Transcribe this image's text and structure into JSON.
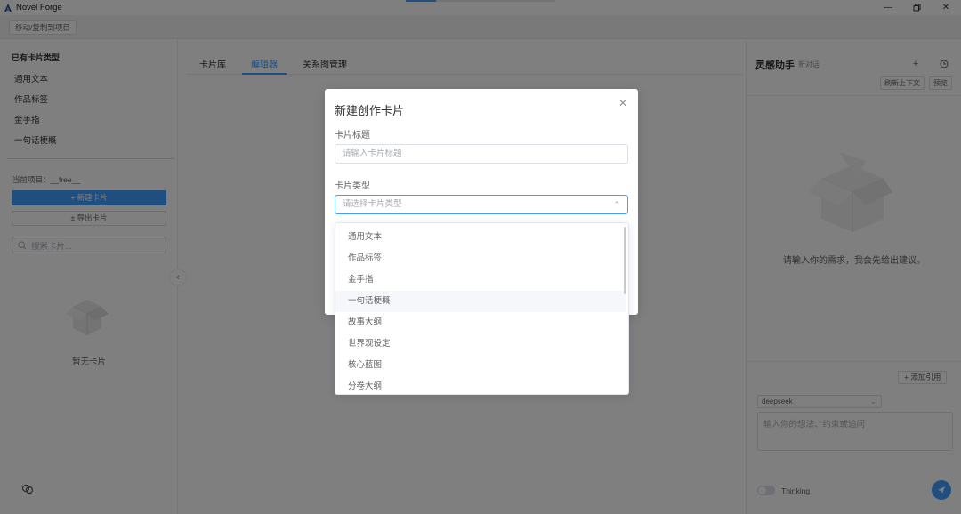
{
  "app": {
    "title": "Novel Forge",
    "progress": 0.2
  },
  "toolbar": {
    "move_copy_label": "移动/复制到项目"
  },
  "sidebar": {
    "section_title": "已有卡片类型",
    "types": [
      "通用文本",
      "作品标签",
      "金手指",
      "一句话梗概"
    ],
    "current_project": "当前项目：__free__",
    "new_card_label": "+ 新建卡片",
    "export_card_label": "± 导出卡片",
    "search_placeholder": "搜索卡片...",
    "empty_text": "暂无卡片"
  },
  "tabs": {
    "items": [
      "卡片库",
      "编辑器",
      "关系图管理"
    ],
    "active_index": 1
  },
  "assistant": {
    "title": "灵感助手",
    "subtitle": "新对话",
    "refresh_label": "刷新上下文",
    "preset_label": "预览",
    "hint": "请输入你的需求，我会先给出建议。",
    "add_ref_label": "+ 添加引用",
    "model": "deepseek",
    "input_placeholder": "输入你的想法、约束或追问",
    "thinking_label": "Thinking"
  },
  "dialog": {
    "title": "新建创作卡片",
    "card_title_label": "卡片标题",
    "card_title_placeholder": "请输入卡片标题",
    "card_type_label": "卡片类型",
    "card_type_placeholder": "请选择卡片类型",
    "options": [
      "通用文本",
      "作品标签",
      "金手指",
      "一句话梗概",
      "故事大纲",
      "世界观设定",
      "核心蓝图",
      "分卷大纲"
    ],
    "hover_index": 3
  },
  "colors": {
    "primary": "#409eff",
    "overlay": "rgba(0,0,0,0.5)"
  },
  "icons": {
    "logo": "app-logo-icon",
    "minimize": "minimize-icon",
    "restore": "restore-icon",
    "close": "close-icon",
    "search": "search-icon",
    "collapse": "chevron-left-icon",
    "add": "plus-icon",
    "history": "history-icon",
    "send": "send-icon",
    "caret": "chevron-up-icon"
  }
}
